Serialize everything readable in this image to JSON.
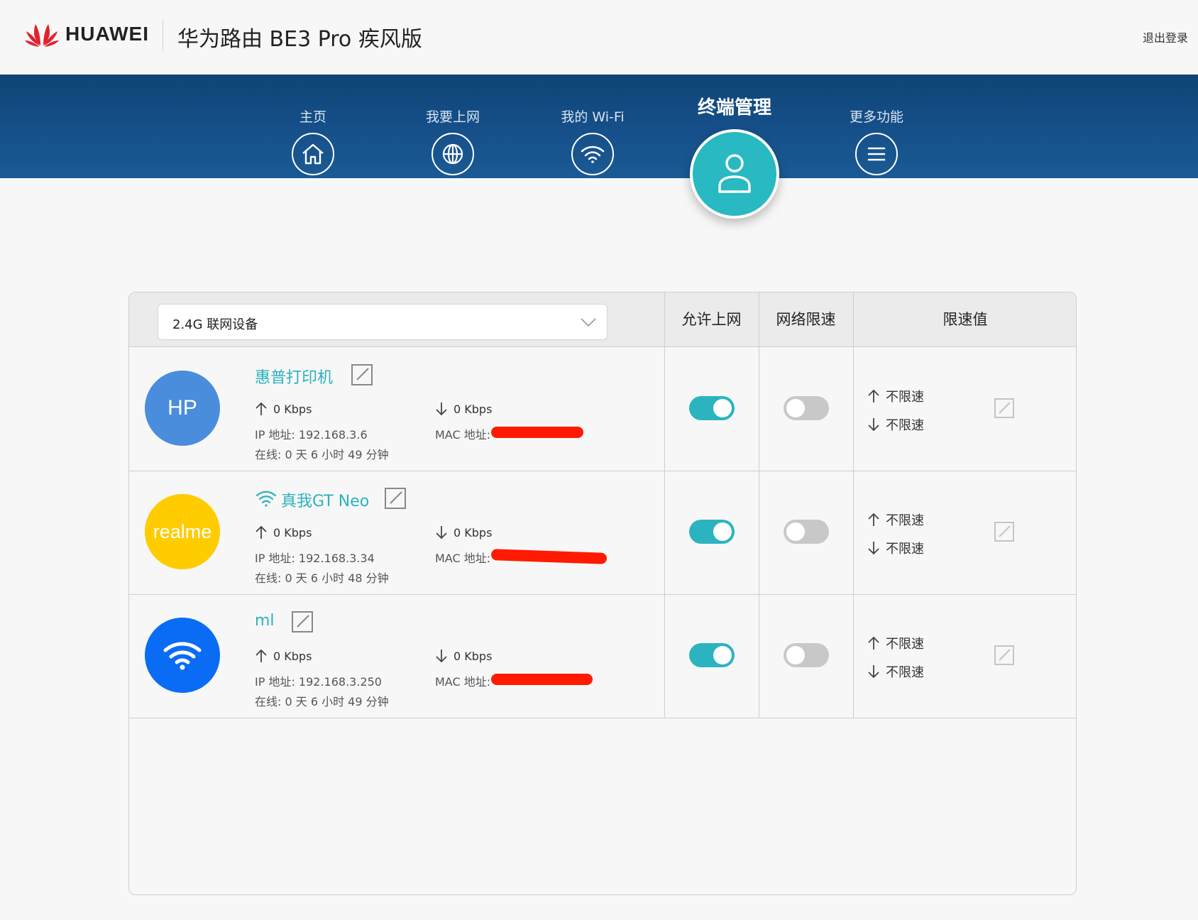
{
  "header": {
    "brand": "HUAWEI",
    "product_title": "华为路由 BE3 Pro 疾风版",
    "logout": "退出登录"
  },
  "nav": {
    "items": [
      {
        "label": "主页",
        "icon": "home-icon"
      },
      {
        "label": "我要上网",
        "icon": "globe-icon"
      },
      {
        "label": "我的 Wi-Fi",
        "icon": "wifi-icon"
      },
      {
        "label": "终端管理",
        "icon": "user-icon",
        "active": true
      },
      {
        "label": "更多功能",
        "icon": "menu-icon"
      }
    ]
  },
  "table": {
    "band_select": "2.4G 联网设备",
    "headers": {
      "allow_internet": "允许上网",
      "speed_limit": "网络限速",
      "limit_value": "限速值"
    }
  },
  "devices": [
    {
      "name": "惠普打印机",
      "avatar_text": "HP",
      "avatar_color": "#4a8ddc",
      "upload": "0 Kbps",
      "download": "0 Kbps",
      "ip": "IP 地址: 192.168.3.6",
      "mac_label": "MAC 地址:",
      "online": "在线: 0 天 6 小时 49 分钟",
      "allow_internet": true,
      "speed_limit": false,
      "up_limit": "不限速",
      "down_limit": "不限速"
    },
    {
      "name": "真我GT Neo",
      "avatar_text": "realme",
      "avatar_color": "#ffcc00",
      "upload": "0 Kbps",
      "download": "0 Kbps",
      "ip": "IP 地址: 192.168.3.34",
      "mac_label": "MAC 地址:",
      "online": "在线: 0 天 6 小时 48 分钟",
      "allow_internet": true,
      "speed_limit": false,
      "up_limit": "不限速",
      "down_limit": "不限速"
    },
    {
      "name": "ml",
      "avatar_text": "",
      "avatar_color": "#0a6cf5",
      "upload": "0 Kbps",
      "download": "0 Kbps",
      "ip": "IP 地址: 192.168.3.250",
      "mac_label": "MAC 地址:",
      "online": "在线: 0 天 6 小时 49 分钟",
      "allow_internet": true,
      "speed_limit": false,
      "up_limit": "不限速",
      "down_limit": "不限速"
    }
  ],
  "colors": {
    "accent": "#2bb4bf",
    "nav_bg": "#16508a",
    "redaction": "#ff1a00"
  }
}
